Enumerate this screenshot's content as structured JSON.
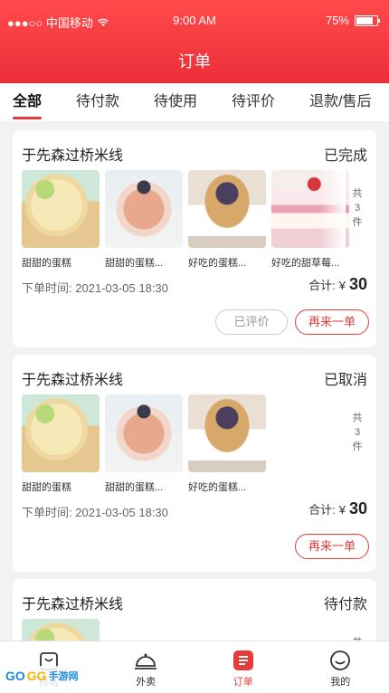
{
  "status_bar": {
    "carrier": "●●●○○ 中国移动",
    "time": "9:00 AM",
    "battery": "75%"
  },
  "header": {
    "title": "订单"
  },
  "tabs": [
    {
      "label": "全部",
      "active": true
    },
    {
      "label": "待付款",
      "active": false
    },
    {
      "label": "待使用",
      "active": false
    },
    {
      "label": "待评价",
      "active": false
    },
    {
      "label": "退款/售后",
      "active": false
    }
  ],
  "orders": [
    {
      "shop": "于先森过桥米线",
      "status": "已完成",
      "products": [
        {
          "name": "甜甜的蛋糕",
          "image": "cupcake-lime"
        },
        {
          "name": "甜甜的蛋糕...",
          "image": "blueberry-cream"
        },
        {
          "name": "好吃的蛋糕...",
          "image": "blackberry-crumble"
        },
        {
          "name": "好吃的甜草莓...",
          "image": "strawberry-cake"
        }
      ],
      "count_lines": [
        "共",
        "3",
        "件"
      ],
      "time_label": "下单时间:",
      "time": "2021-03-05 18:30",
      "total_label": "合计:",
      "currency": "¥",
      "amount": "30",
      "buttons": [
        "已评价",
        "再来一单"
      ]
    },
    {
      "shop": "于先森过桥米线",
      "status": "已取消",
      "products": [
        {
          "name": "甜甜的蛋糕",
          "image": "cupcake-lime"
        },
        {
          "name": "甜甜的蛋糕...",
          "image": "blueberry-cream"
        },
        {
          "name": "好吃的蛋糕...",
          "image": "blackberry-crumble"
        }
      ],
      "count_lines": [
        "共",
        "3",
        "件"
      ],
      "time_label": "下单时间:",
      "time": "2021-03-05 18:30",
      "total_label": "合计:",
      "currency": "¥",
      "amount": "30",
      "buttons": [
        "再来一单"
      ]
    },
    {
      "shop": "于先森过桥米线",
      "status": "待付款",
      "count_lines": [
        "共"
      ]
    }
  ],
  "tabbar": [
    {
      "label": "商城",
      "icon": "shop-bag-icon",
      "active": false
    },
    {
      "label": "外卖",
      "icon": "cloche-icon",
      "active": false
    },
    {
      "label": "订单",
      "icon": "order-list-icon",
      "active": true
    },
    {
      "label": "我的",
      "icon": "smiley-user-icon",
      "active": false
    }
  ],
  "watermark": {
    "brand_a": "GO",
    "brand_b": "GG",
    "suffix": "手游网"
  },
  "colors": {
    "accent": "#e83a3a",
    "header_top": "#ff4a4a",
    "background": "#f2f2f2"
  }
}
